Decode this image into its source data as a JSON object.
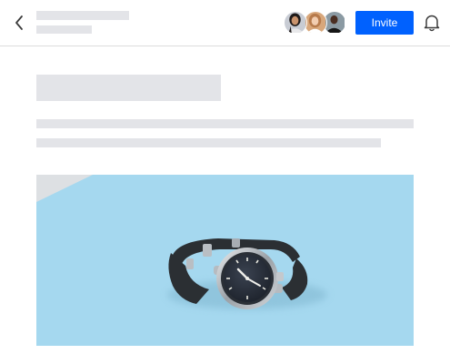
{
  "header": {
    "back_icon": "chevron-left-icon",
    "invite_label": "Invite",
    "bell_icon": "bell-icon",
    "avatars": [
      {
        "name": "avatar-1"
      },
      {
        "name": "avatar-2"
      },
      {
        "name": "avatar-3"
      }
    ]
  },
  "colors": {
    "accent": "#0061fe",
    "skeleton": "#e3e4e8",
    "hero_background": "#a5d8ef",
    "divider": "#dcdcdc"
  },
  "hero": {
    "subject": "wristwatch"
  }
}
